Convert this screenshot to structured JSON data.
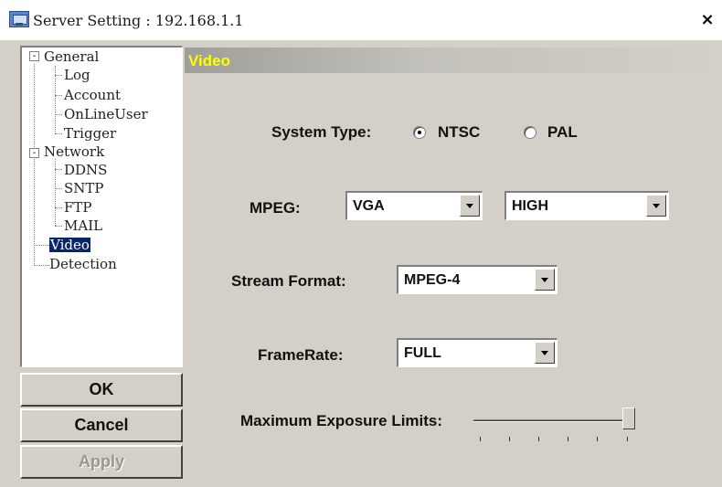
{
  "window": {
    "title": "Server Setting : 192.168.1.1",
    "close_glyph": "×"
  },
  "tree": {
    "general": "General",
    "log": "Log",
    "account": "Account",
    "online_user": "OnLineUser",
    "trigger": "Trigger",
    "network": "Network",
    "ddns": "DDNS",
    "sntp": "SNTP",
    "ftp": "FTP",
    "mail": "MAIL",
    "video": "Video",
    "detection": "Detection",
    "expanded_glyph": "-"
  },
  "buttons": {
    "ok": "OK",
    "cancel": "Cancel",
    "apply": "Apply"
  },
  "panel": {
    "title": "Video",
    "title_color": "#ffff00"
  },
  "form": {
    "system_type_label": "System Type:",
    "system_type_options": [
      "NTSC",
      "PAL"
    ],
    "system_type_selected": "NTSC",
    "mpeg_label": "MPEG:",
    "mpeg_resolution": "VGA",
    "mpeg_quality": "HIGH",
    "stream_format_label": "Stream Format:",
    "stream_format": "MPEG-4",
    "frame_rate_label": "FrameRate:",
    "frame_rate": "FULL",
    "exposure_label": "Maximum Exposure Limits:",
    "exposure_level_fraction": 1.0
  },
  "colors": {
    "selection": "#0a246a",
    "face": "#d4d0c8"
  },
  "icons": {
    "app": "monitor-icon",
    "close": "close-icon",
    "combo_arrow": "chevron-down-icon"
  }
}
